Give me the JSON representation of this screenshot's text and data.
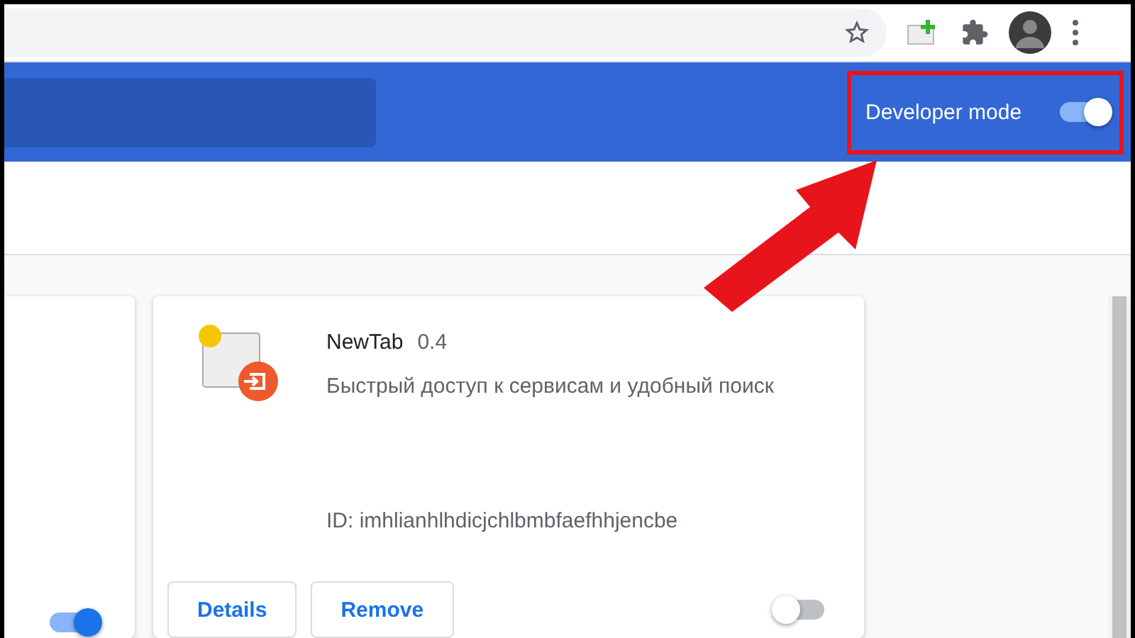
{
  "header": {
    "developer_mode": {
      "label": "Developer mode",
      "on": true
    }
  },
  "cards": [
    {
      "kind": "partial",
      "enabled": true
    },
    {
      "kind": "full",
      "name": "NewTab",
      "version": "0.4",
      "description": "Быстрый доступ к сервисам и удобный поиск",
      "id": "ID: imhlianhlhdicjchlbmbfaefhhjencbe",
      "buttons": [
        "Details",
        "Remove"
      ],
      "enabled": false
    }
  ]
}
